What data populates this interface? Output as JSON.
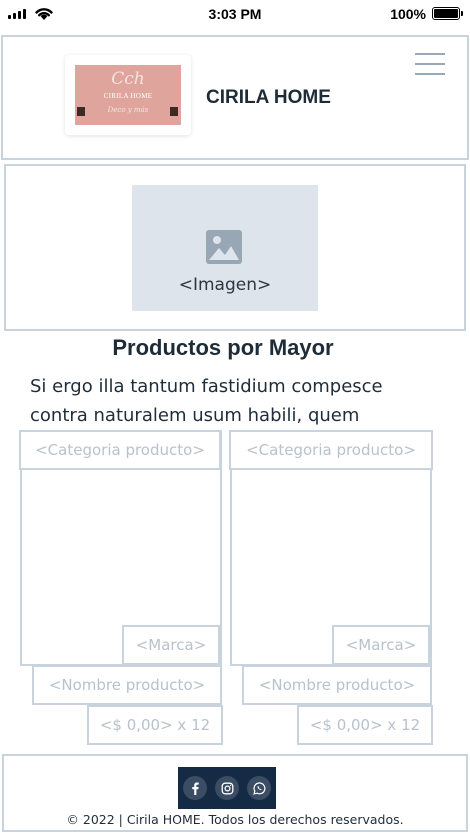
{
  "status_bar": {
    "time": "3:03 PM",
    "battery_percent": "100%",
    "battery_level": 1.0
  },
  "header": {
    "logo": {
      "script_text": "Cch",
      "name_text": "CIRILA HOME",
      "tagline_text": "Deco y más"
    },
    "brand_name": "CIRILA HOME",
    "menu_icon": "hamburger-icon"
  },
  "hero": {
    "image_label": "<Imagen>",
    "image_icon": "image-icon"
  },
  "section": {
    "title": "Productos por Mayor",
    "body": "Si ergo illa tantum fastidium compesce contra naturalem usum habili, quem"
  },
  "products": [
    {
      "category": "<Categoria producto>",
      "brand": "<Marca>",
      "name": "<Nombre producto>",
      "price": "<$ 0,00> x 12"
    },
    {
      "category": "<Categoria producto>",
      "brand": "<Marca>",
      "name": "<Nombre producto>",
      "price": "<$ 0,00> x 12"
    }
  ],
  "footer": {
    "social": [
      "facebook-icon",
      "instagram-icon",
      "whatsapp-icon"
    ],
    "copyright": "© 2022 | Cirila HOME. Todos los derechos reservados."
  },
  "colors": {
    "border": "#c9d3dd",
    "placeholder_text": "#b8c2cc",
    "image_bg": "#dde4ec",
    "logo_bg": "#dfa59c",
    "social_bar_bg": "#152a44",
    "title_text": "#1e2c38"
  }
}
